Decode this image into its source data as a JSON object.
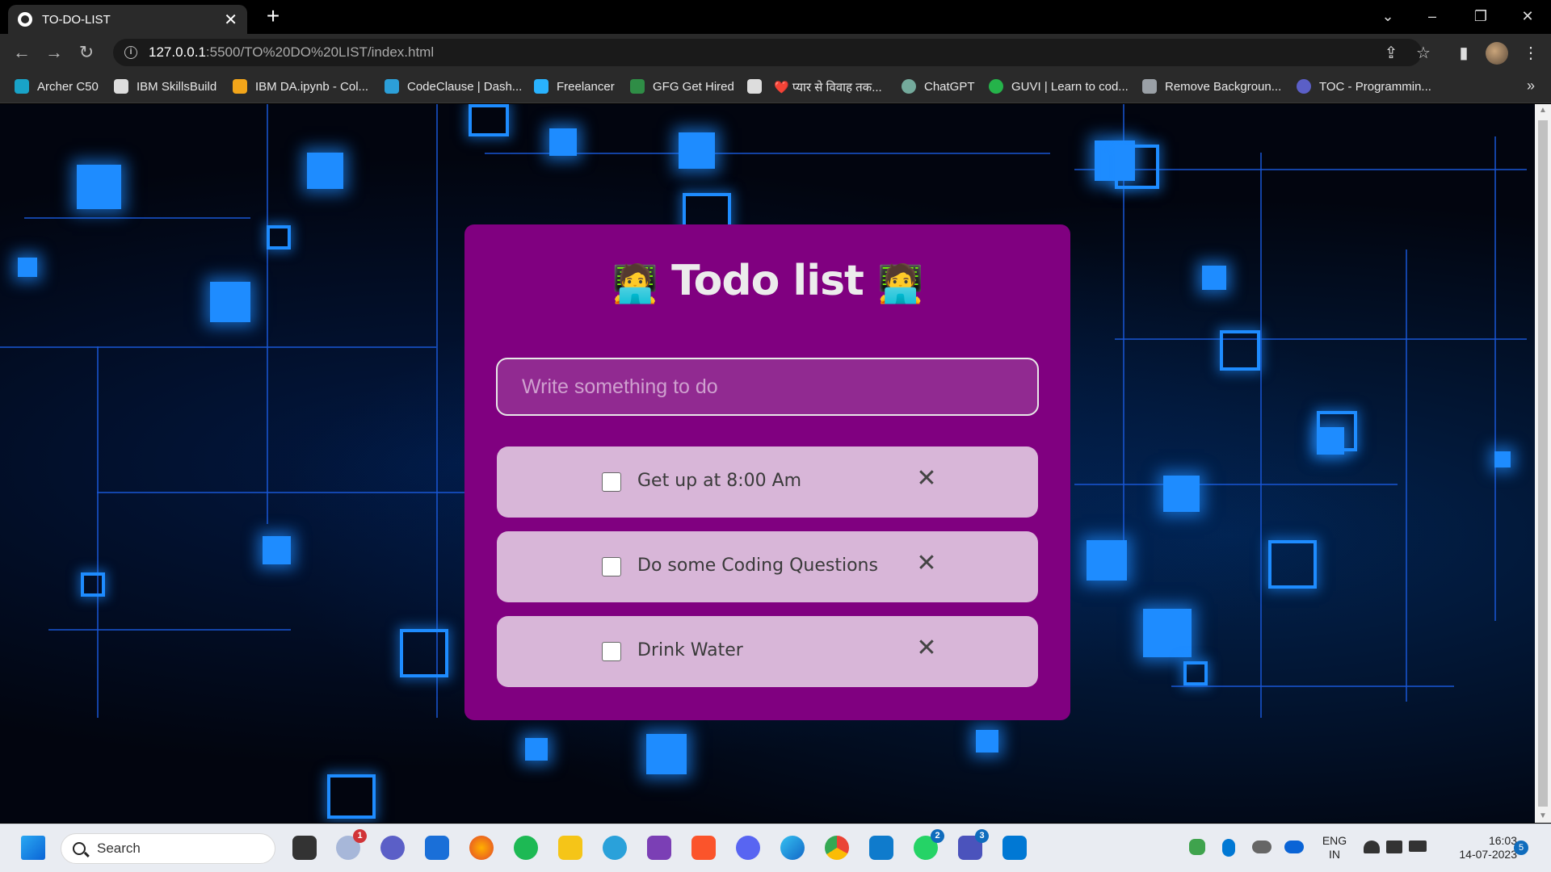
{
  "browser": {
    "tab_title": "TO-DO-LIST",
    "tab_close": "✕",
    "new_tab": "+",
    "url_host": "127.0.0.1",
    "url_path": ":5500/TO%20DO%20LIST/index.html",
    "bookmarks": [
      {
        "label": "Archer C50",
        "color": "#19a3c8"
      },
      {
        "label": "IBM SkillsBuild",
        "color": "#dddddd"
      },
      {
        "label": "IBM DA.ipynb - Col...",
        "color": "#f2a51a"
      },
      {
        "label": "CodeClause | Dash...",
        "color": "#2c9fd8"
      },
      {
        "label": "Freelancer",
        "color": "#29b2fe"
      },
      {
        "label": "GFG Get Hired",
        "color": "#2f8d46"
      },
      {
        "label": "",
        "color": "#dddddd"
      },
      {
        "label": "❤️ प्यार से विवाह तक...",
        "color": "#e33b3b"
      },
      {
        "label": "ChatGPT",
        "color": "#74aa9c"
      },
      {
        "label": "GUVI | Learn to cod...",
        "color": "#25b34a"
      },
      {
        "label": "Remove Backgroun...",
        "color": "#9aa0a6"
      },
      {
        "label": "TOC - Programmin...",
        "color": "#5b5fc7"
      }
    ],
    "bookmarks_more": "»"
  },
  "todo": {
    "title": "Todo list",
    "emoji_left": "🧑‍💻",
    "emoji_right": "🧑‍💻",
    "input_placeholder": "Write something to do",
    "delete_symbol": "✕",
    "items": [
      {
        "text": "Get up at 8:00 Am",
        "checked": false
      },
      {
        "text": "Do some Coding Questions",
        "checked": false
      },
      {
        "text": "Drink Water",
        "checked": false
      }
    ]
  },
  "taskbar": {
    "search_label": "Search",
    "weather_badge": "1",
    "whatsapp_badge": "2",
    "teams_badge": "3",
    "language": "ENG",
    "region": "IN",
    "time": "16:03",
    "date": "14-07-2023",
    "notification_count": "5"
  },
  "colors": {
    "card": "#800080",
    "item": "#d8b6d8",
    "input_bg": "#912a91",
    "circuit": "#1e8cff"
  }
}
